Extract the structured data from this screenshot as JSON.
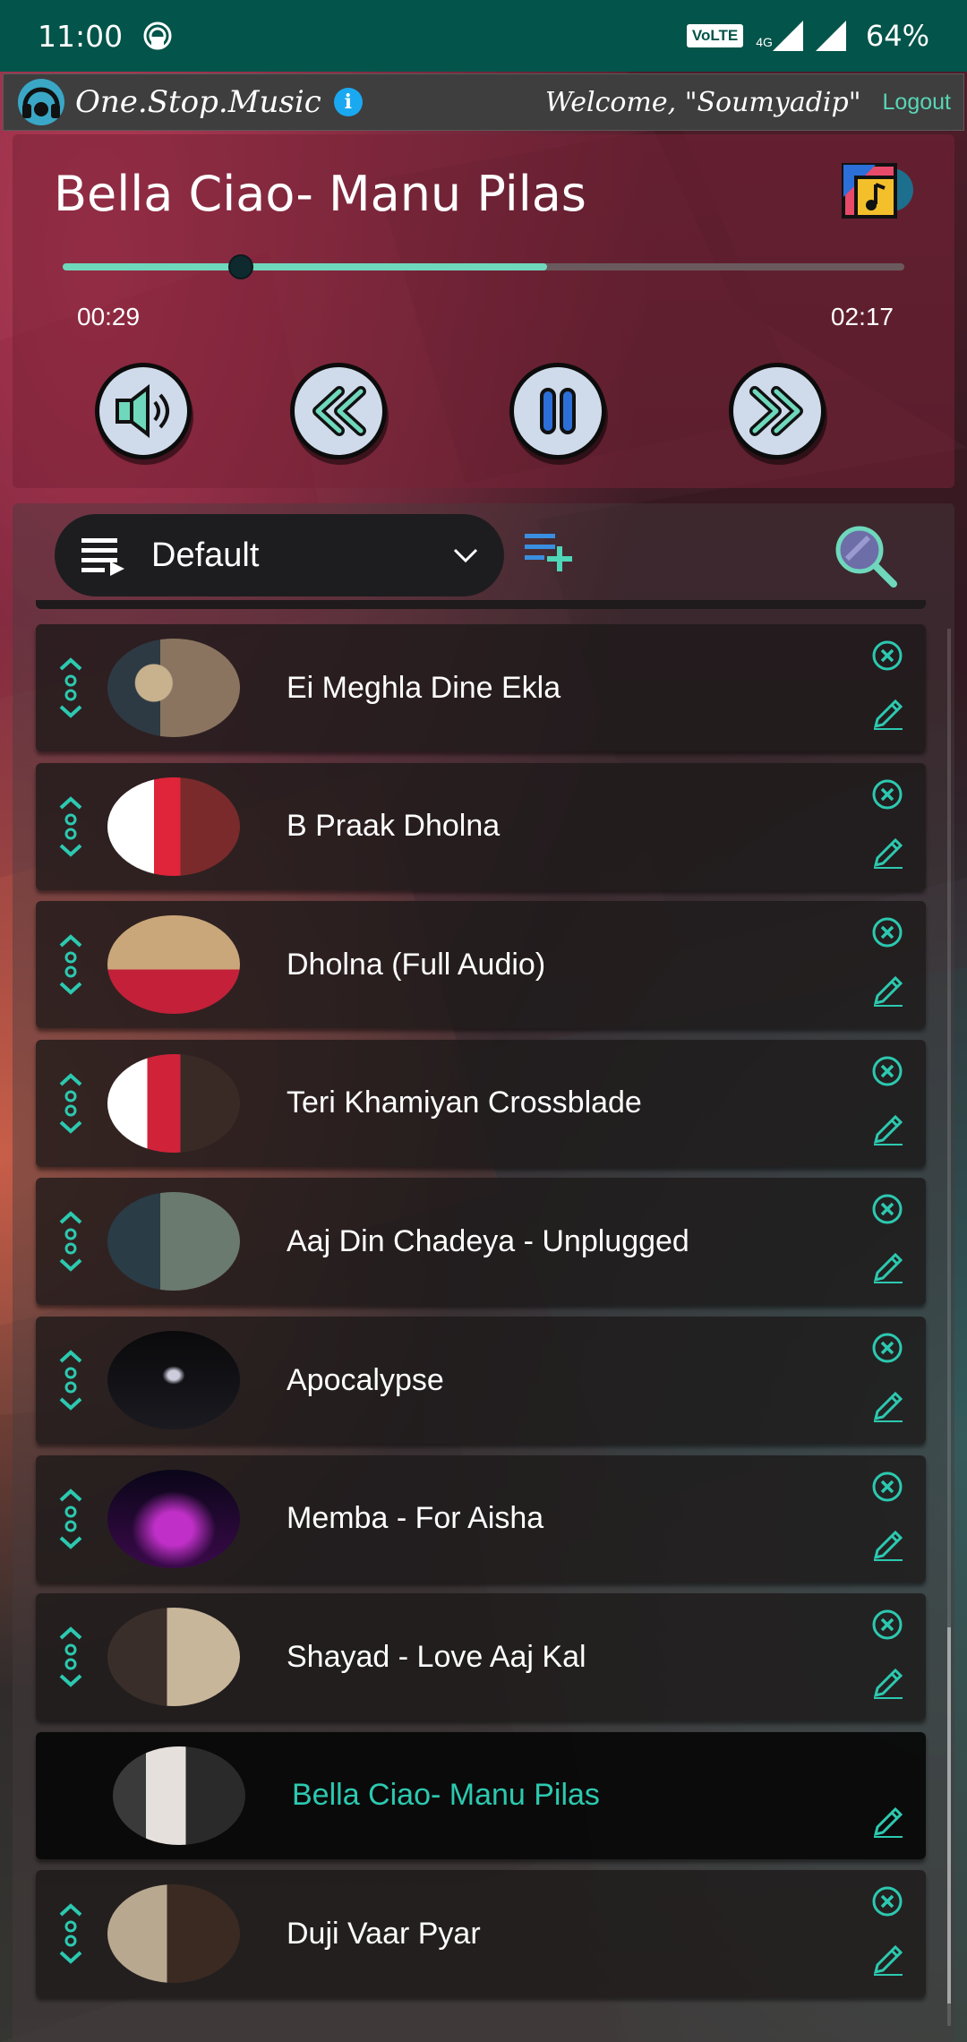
{
  "status_bar": {
    "time": "11:00",
    "network_badge": "VoLTE",
    "network_type": "4G",
    "battery": "64%"
  },
  "app_bar": {
    "title": "One.Stop.Music",
    "welcome": "Welcome, \"Soumyadip\"",
    "logout_label": "Logout"
  },
  "player": {
    "song_title": "Bella Ciao- Manu Pilas",
    "elapsed": "00:29",
    "duration": "02:17",
    "progress_fraction": 0.212,
    "buffered_fraction": 0.575
  },
  "playlist": {
    "selected": "Default",
    "songs": [
      {
        "title": "Ei Meghla Dine Ekla",
        "active": false
      },
      {
        "title": "B Praak Dholna",
        "active": false
      },
      {
        "title": "Dholna (Full Audio)",
        "active": false
      },
      {
        "title": "Teri Khamiyan Crossblade",
        "active": false
      },
      {
        "title": "Aaj Din Chadeya - Unplugged",
        "active": false
      },
      {
        "title": "Apocalypse",
        "active": false
      },
      {
        "title": "Memba - For Aisha",
        "active": false
      },
      {
        "title": "Shayad - Love Aaj Kal",
        "active": false
      },
      {
        "title": "Bella Ciao- Manu Pilas",
        "active": true
      },
      {
        "title": "Duji Vaar Pyar",
        "active": false
      }
    ]
  },
  "colors": {
    "accent": "#2cc9b0",
    "status_bar": "#03544a",
    "seek_fill": "#6fd8bc",
    "info": "#1aa9f0"
  }
}
